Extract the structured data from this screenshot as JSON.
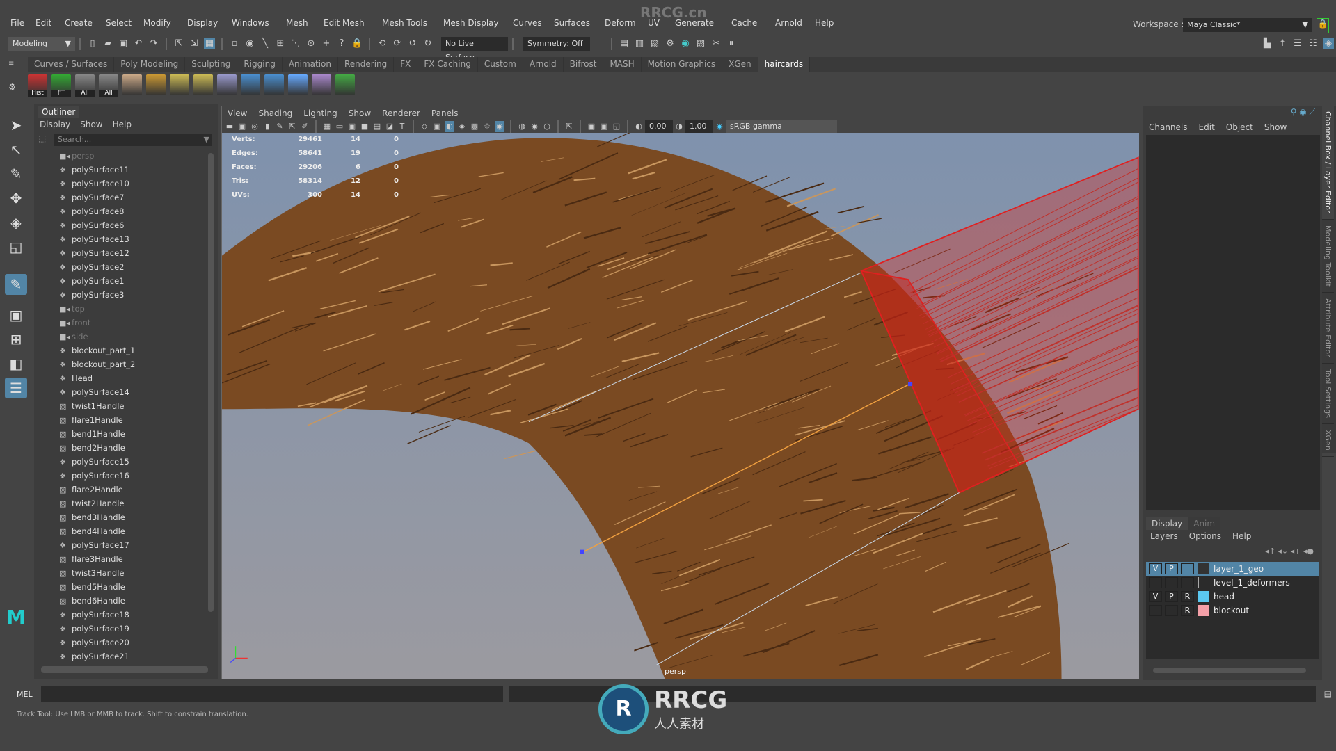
{
  "menus": [
    "File",
    "Edit",
    "Create",
    "Select",
    "Modify",
    "Display",
    "Windows",
    "Mesh",
    "Edit Mesh",
    "Mesh Tools",
    "Mesh Display",
    "Curves",
    "Surfaces",
    "Deform",
    "UV",
    "Generate",
    "Cache",
    "Arnold",
    "Help"
  ],
  "watermark": "RRCG.cn",
  "workspace": {
    "label": "Workspace :",
    "value": "Maya Classic*"
  },
  "toolbar": {
    "mode": "Modeling",
    "live_surface": "No Live Surface",
    "symmetry": "Symmetry: Off"
  },
  "shelf_tabs": [
    "Curves / Surfaces",
    "Poly Modeling",
    "Sculpting",
    "Rigging",
    "Animation",
    "Rendering",
    "FX",
    "FX Caching",
    "Custom",
    "Arnold",
    "Bifrost",
    "MASH",
    "Motion Graphics",
    "XGen",
    "haircards"
  ],
  "shelf_active": "haircards",
  "shelf_labels": [
    "Hist",
    "FT",
    "All",
    "All"
  ],
  "outliner": {
    "title": "Outliner",
    "menu": [
      "Display",
      "Show",
      "Help"
    ],
    "search_placeholder": "Search...",
    "items": [
      {
        "n": "persp",
        "t": "cam"
      },
      {
        "n": "polySurface11",
        "t": "mesh"
      },
      {
        "n": "polySurface10",
        "t": "mesh"
      },
      {
        "n": "polySurface7",
        "t": "mesh"
      },
      {
        "n": "polySurface8",
        "t": "mesh"
      },
      {
        "n": "polySurface6",
        "t": "mesh"
      },
      {
        "n": "polySurface13",
        "t": "mesh"
      },
      {
        "n": "polySurface12",
        "t": "mesh"
      },
      {
        "n": "polySurface2",
        "t": "mesh"
      },
      {
        "n": "polySurface1",
        "t": "mesh"
      },
      {
        "n": "polySurface3",
        "t": "mesh"
      },
      {
        "n": "top",
        "t": "cam"
      },
      {
        "n": "front",
        "t": "cam"
      },
      {
        "n": "side",
        "t": "cam"
      },
      {
        "n": "blockout_part_1",
        "t": "mesh"
      },
      {
        "n": "blockout_part_2",
        "t": "mesh"
      },
      {
        "n": "Head",
        "t": "mesh"
      },
      {
        "n": "polySurface14",
        "t": "mesh"
      },
      {
        "n": "twist1Handle",
        "t": "handle"
      },
      {
        "n": "flare1Handle",
        "t": "handle"
      },
      {
        "n": "bend1Handle",
        "t": "handle"
      },
      {
        "n": "bend2Handle",
        "t": "handle"
      },
      {
        "n": "polySurface15",
        "t": "mesh"
      },
      {
        "n": "polySurface16",
        "t": "mesh"
      },
      {
        "n": "flare2Handle",
        "t": "handle"
      },
      {
        "n": "twist2Handle",
        "t": "handle"
      },
      {
        "n": "bend3Handle",
        "t": "handle"
      },
      {
        "n": "bend4Handle",
        "t": "handle"
      },
      {
        "n": "polySurface17",
        "t": "mesh"
      },
      {
        "n": "flare3Handle",
        "t": "handle"
      },
      {
        "n": "twist3Handle",
        "t": "handle"
      },
      {
        "n": "bend5Handle",
        "t": "handle"
      },
      {
        "n": "bend6Handle",
        "t": "handle"
      },
      {
        "n": "polySurface18",
        "t": "mesh"
      },
      {
        "n": "polySurface19",
        "t": "mesh"
      },
      {
        "n": "polySurface20",
        "t": "mesh"
      },
      {
        "n": "polySurface21",
        "t": "mesh"
      }
    ]
  },
  "viewport": {
    "menu": [
      "View",
      "Shading",
      "Lighting",
      "Show",
      "Renderer",
      "Panels"
    ],
    "exposure": "0.00",
    "gamma": "1.00",
    "color_space": "sRGB gamma",
    "camera": "persp",
    "stats": [
      {
        "label": "Verts:",
        "a": "29461",
        "b": "14",
        "c": "0"
      },
      {
        "label": "Edges:",
        "a": "58641",
        "b": "19",
        "c": "0"
      },
      {
        "label": "Faces:",
        "a": "29206",
        "b": "6",
        "c": "0"
      },
      {
        "label": "Tris:",
        "a": "58314",
        "b": "12",
        "c": "0"
      },
      {
        "label": "UVs:",
        "a": "300",
        "b": "14",
        "c": "0"
      }
    ]
  },
  "channel_box": {
    "menu": [
      "Channels",
      "Edit",
      "Object",
      "Show"
    ]
  },
  "layer_editor": {
    "tabs": [
      "Display",
      "Anim"
    ],
    "menu": [
      "Layers",
      "Options",
      "Help"
    ],
    "layers": [
      {
        "name": "layer_1_geo",
        "v": "V",
        "p": "P",
        "r": "",
        "color": "#333333",
        "selected": true
      },
      {
        "name": "level_1_deformers",
        "v": "",
        "p": "",
        "r": "",
        "color": "",
        "selected": false
      },
      {
        "name": "head",
        "v": "V",
        "p": "P",
        "r": "R",
        "color": "#5bc8f0",
        "selected": false
      },
      {
        "name": "blockout",
        "v": "",
        "p": "",
        "r": "R",
        "color": "#f4a0a8",
        "selected": false
      }
    ]
  },
  "side_tabs": [
    "Channel Box / Layer Editor",
    "Modeling Toolkit",
    "Attribute Editor",
    "Tool Settings",
    "XGen"
  ],
  "command": {
    "language": "MEL",
    "help_line": "Track Tool: Use LMB or MMB to track. Shift to constrain translation."
  },
  "logo": {
    "text": "RRCG",
    "sub": "人人素材"
  },
  "colors": {
    "accent": "#5285a6",
    "selection_red": "#e02020",
    "hair": "#7a4a22",
    "viewport_bg": "#8a98ad"
  }
}
